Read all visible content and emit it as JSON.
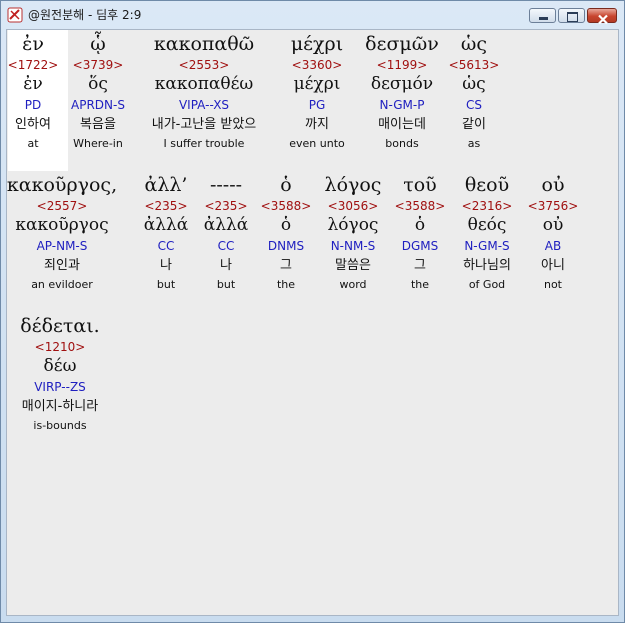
{
  "window": {
    "title": "@원전분해 - 딤후 2:9",
    "icon": "app-icon",
    "controls": {
      "minimize": "minimize-icon",
      "maximize": "maximize-icon",
      "close": "close-icon"
    }
  },
  "rows": [
    {
      "words": [
        {
          "greek": "ἐν",
          "strongs": "<1722>",
          "lemma": "ἐν",
          "parse": "PD",
          "korean": "인하여",
          "english": "at"
        },
        {
          "greek": "ᾧ",
          "strongs": "<3739>",
          "lemma": "ὅς",
          "parse": "APRDN-S",
          "korean": "복음을",
          "english": "Where-in"
        },
        {
          "greek": "κακοπαθῶ",
          "strongs": "<2553>",
          "lemma": "κακοπαθέω",
          "parse": "VIPA--XS",
          "korean": "내가-고난을 받았으",
          "english": "I suffer trouble"
        },
        {
          "greek": "μέχρι",
          "strongs": "<3360>",
          "lemma": "μέχρι",
          "parse": "PG",
          "korean": "까지",
          "english": "even unto"
        },
        {
          "greek": "δεσμῶν",
          "strongs": "<1199>",
          "lemma": "δεσμόν",
          "parse": "N-GM-P",
          "korean": "매이는데",
          "english": "bonds"
        },
        {
          "greek": "ὡς",
          "strongs": "<5613>",
          "lemma": "ὡς",
          "parse": "CS",
          "korean": "같이",
          "english": "as"
        }
      ]
    },
    {
      "words": [
        {
          "greek": "κακοῦργος,",
          "strongs": "<2557>",
          "lemma": "κακοῦργος",
          "parse": "AP-NM-S",
          "korean": "죄인과",
          "english": "an evildoer"
        },
        {
          "greek": "ἀλλ’",
          "strongs": "<235>",
          "lemma": "ἀλλά",
          "parse": "CC",
          "korean": "나",
          "english": "but"
        },
        {
          "greek": "-----",
          "strongs": "<235>",
          "lemma": "ἀλλά",
          "parse": "CC",
          "korean": "나",
          "english": "but"
        },
        {
          "greek": "ὁ",
          "strongs": "<3588>",
          "lemma": "ὁ",
          "parse": "DNMS",
          "korean": "그",
          "english": "the"
        },
        {
          "greek": "λόγος",
          "strongs": "<3056>",
          "lemma": "λόγος",
          "parse": "N-NM-S",
          "korean": "말씀은",
          "english": "word"
        },
        {
          "greek": "τοῦ",
          "strongs": "<3588>",
          "lemma": "ὁ",
          "parse": "DGMS",
          "korean": "그",
          "english": "the"
        },
        {
          "greek": "θεοῦ",
          "strongs": "<2316>",
          "lemma": "θεός",
          "parse": "N-GM-S",
          "korean": "하나님의",
          "english": "of God"
        },
        {
          "greek": "οὐ",
          "strongs": "<3756>",
          "lemma": "οὐ",
          "parse": "AB",
          "korean": "아니",
          "english": "not"
        }
      ]
    },
    {
      "words": [
        {
          "greek": "δέδεται.",
          "strongs": "<1210>",
          "lemma": "δέω",
          "parse": "VIRP--ZS",
          "korean": "매이지-하니라",
          "english": "is-bounds"
        }
      ]
    }
  ]
}
